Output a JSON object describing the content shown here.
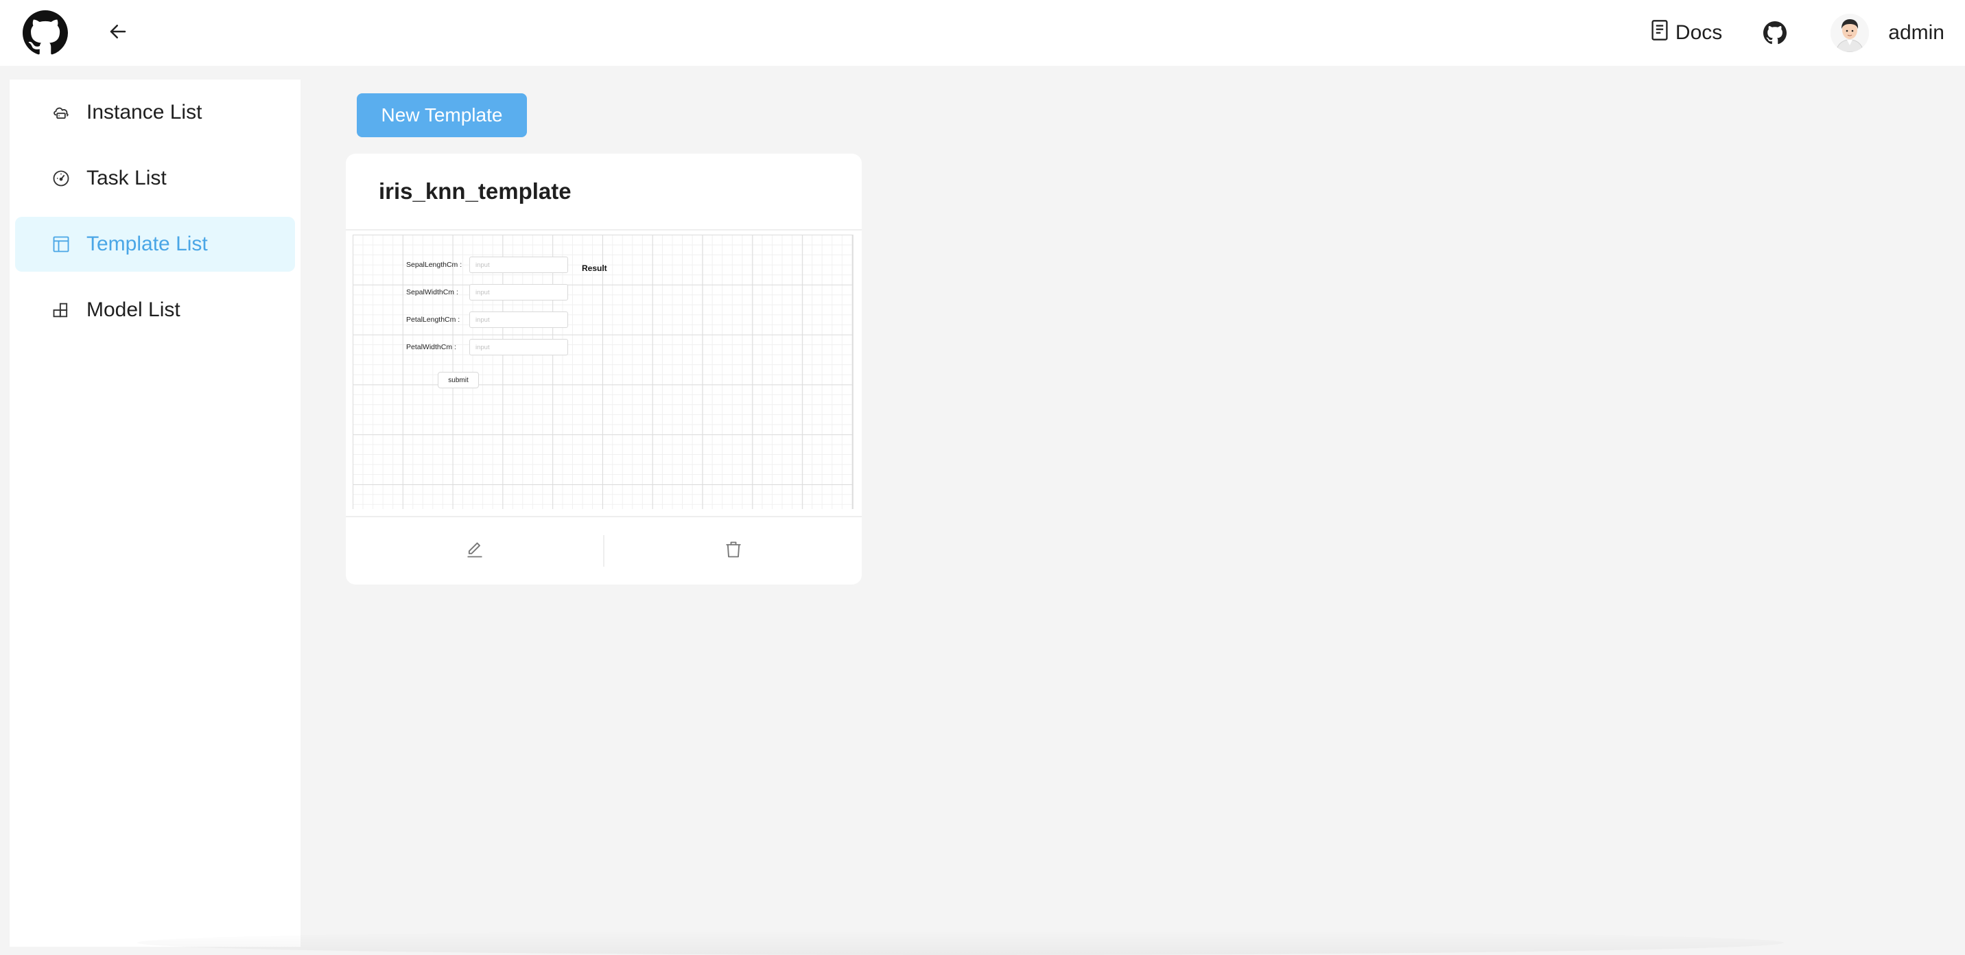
{
  "header": {
    "docs_label": "Docs",
    "username": "admin",
    "icons": {
      "logo": "github-logo-icon",
      "back": "arrow-left-icon",
      "docs": "document-icon",
      "github": "github-icon",
      "avatar": "user-avatar"
    }
  },
  "sidebar": {
    "items": [
      {
        "label": "Instance List",
        "icon": "cloud-server-icon",
        "active": false
      },
      {
        "label": "Task List",
        "icon": "dashboard-gauge-icon",
        "active": false
      },
      {
        "label": "Template List",
        "icon": "layout-icon",
        "active": true
      },
      {
        "label": "Model List",
        "icon": "blocks-icon",
        "active": false
      }
    ]
  },
  "main": {
    "new_button_label": "New Template",
    "cards": [
      {
        "title": "iris_knn_template",
        "preview": {
          "fields": [
            {
              "label": "SepalLengthCm :",
              "placeholder": "input"
            },
            {
              "label": "SepalWidthCm :",
              "placeholder": "input"
            },
            {
              "label": "PetalLengthCm :",
              "placeholder": "input"
            },
            {
              "label": "PetalWidthCm :",
              "placeholder": "input"
            }
          ],
          "result_label": "Result",
          "submit_label": "submit"
        },
        "actions": [
          {
            "icon": "edit-icon"
          },
          {
            "icon": "trash-icon"
          }
        ]
      }
    ]
  },
  "colors": {
    "accent": "#5aaeee",
    "active_bg": "#e6f8fe",
    "active_text": "#4aa6e6",
    "page_bg": "#f4f4f4"
  }
}
